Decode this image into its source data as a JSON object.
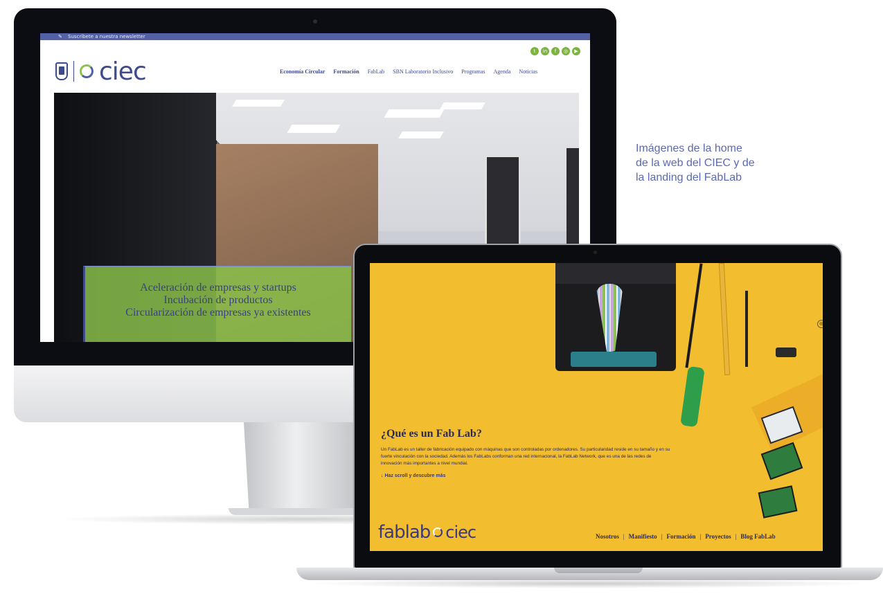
{
  "caption": {
    "line1": "Imágenes de la home",
    "line2": "de la web del CIEC y de",
    "line3": "la landing del FabLab"
  },
  "ciec_site": {
    "newsletter": "Suscríbete a nuestra newsletter",
    "logo_text": "ciec",
    "social_icons": [
      "twitter-icon",
      "linkedin-icon",
      "facebook-icon",
      "instagram-icon",
      "youtube-icon"
    ],
    "nav": [
      "Economía Circular",
      "Formación",
      "FabLab",
      "SBN Laboratorio Inclusivo",
      "Programas",
      "Agenda",
      "Noticias"
    ],
    "hero": {
      "line1": "Aceleración de empresas y startups",
      "line2": "Incubación de productos",
      "line3": "Circularización de empresas ya existentes"
    },
    "colors": {
      "primary": "#3e4a8c",
      "accent": "#8bc34a",
      "topbar": "#5460a6"
    }
  },
  "fablab_site": {
    "title": "¿Qué es un Fab Lab?",
    "description": "Un FabLab es un taller de fabricación equipado con máquinas que son controladas por ordenadores. Su particularidad reside en su tamaño y en su fuerte vinculación con la sociedad. Además los FabLabs conforman una red internacional, la FabLab Network, que es una de las redes de innovación más importantes a nivel mundial.",
    "scroll_cta": "Haz scroll y descubre más",
    "logo_fablab": "fablab",
    "logo_ciec": "ciec",
    "nav": [
      "Nosotros",
      "Manifiesto",
      "Formación",
      "Proyectos",
      "Blog FabLab"
    ],
    "separator": "|",
    "colors": {
      "background": "#f2bd2f",
      "text": "#2d2a52"
    }
  }
}
